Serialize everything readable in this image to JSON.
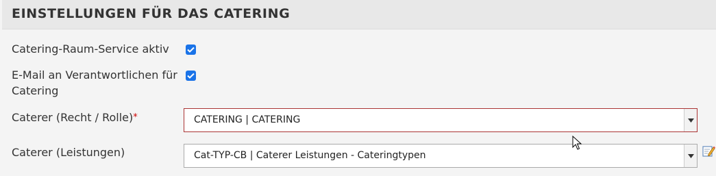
{
  "section": {
    "title": "EINSTELLUNGEN FÜR DAS CATERING"
  },
  "fields": {
    "room_service": {
      "label": "Catering-Raum-Service aktiv",
      "checked": true
    },
    "email_responsible": {
      "label_line1": "E-Mail an Verantwortlichen für",
      "label_line2": "Catering",
      "checked": true
    },
    "caterer_role": {
      "label": "Caterer (Recht / Rolle)",
      "required_mark": "*",
      "value": "CATERING | CATERING"
    },
    "caterer_services": {
      "label": "Caterer (Leistungen)",
      "value": "Cat-TYP-CB | Caterer Leistungen - Cateringtypen"
    }
  },
  "icons": {
    "checkbox": "checkmark-icon",
    "dropdown": "chevron-down-icon",
    "edit": "edit-pencil-icon",
    "cursor": "mouse-pointer-icon"
  },
  "colors": {
    "checkbox": "#1a73e8",
    "required": "#cc0000",
    "error_border": "#aa3333"
  }
}
